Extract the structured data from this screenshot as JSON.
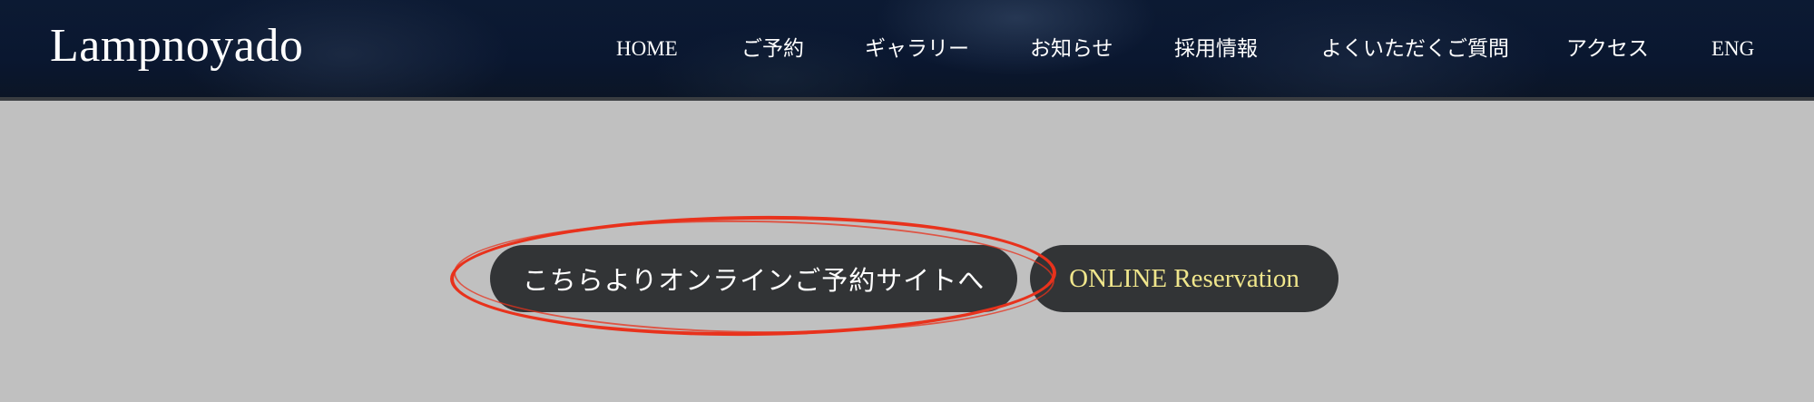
{
  "header": {
    "logo_text": "Lampnoyado"
  },
  "nav": {
    "items": [
      {
        "label": "HOME"
      },
      {
        "label": "ご予約"
      },
      {
        "label": "ギャラリー"
      },
      {
        "label": "お知らせ"
      },
      {
        "label": "採用情報"
      },
      {
        "label": "よくいただくご質問"
      },
      {
        "label": "アクセス"
      },
      {
        "label": "ENG"
      }
    ]
  },
  "main": {
    "reservation_button_jp": "こちらよりオンラインご予約サイトへ",
    "reservation_button_en": "ONLINE Reservation"
  },
  "colors": {
    "header_bg": "#0b1730",
    "page_bg": "#c0c0c0",
    "button_bg": "#323436",
    "en_button_text": "#f0e68c",
    "annotation": "#e8321c"
  }
}
